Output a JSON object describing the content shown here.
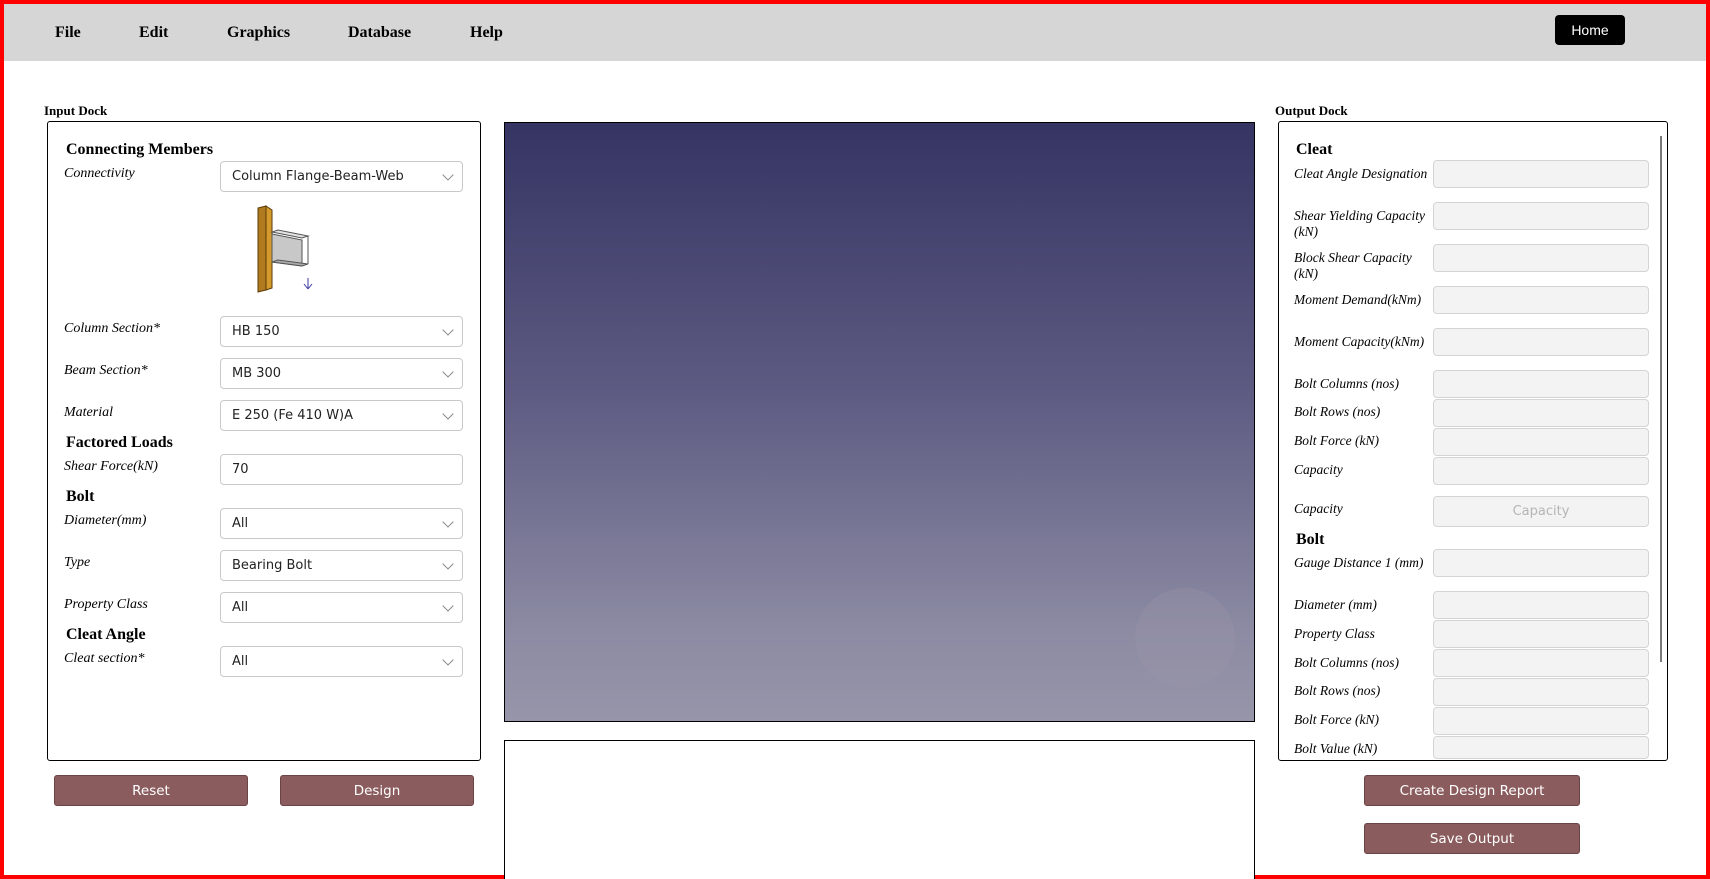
{
  "menubar": {
    "items": [
      "File",
      "Edit",
      "Graphics",
      "Database",
      "Help"
    ],
    "home_label": "Home"
  },
  "input_dock": {
    "title": "Input Dock",
    "sections": {
      "connecting_members": "Connecting Members",
      "factored_loads": "Factored Loads",
      "bolt": "Bolt",
      "cleat_angle": "Cleat Angle"
    },
    "fields": {
      "connectivity": {
        "label": "Connectivity",
        "value": "Column Flange-Beam-Web"
      },
      "column_section": {
        "label": "Column Section*",
        "value": "HB 150"
      },
      "beam_section": {
        "label": "Beam Section*",
        "value": "MB 300"
      },
      "material": {
        "label": "Material",
        "value": "E 250 (Fe 410 W)A"
      },
      "shear_force": {
        "label": "Shear Force(kN)",
        "value": "70"
      },
      "diameter": {
        "label": "Diameter(mm)",
        "value": "All"
      },
      "type": {
        "label": "Type",
        "value": "Bearing Bolt"
      },
      "property_class": {
        "label": "Property Class",
        "value": "All"
      },
      "cleat_section": {
        "label": "Cleat section*",
        "value": "All"
      }
    },
    "buttons": {
      "reset": "Reset",
      "design": "Design"
    }
  },
  "output_dock": {
    "title": "Output Dock",
    "sections": {
      "cleat": "Cleat",
      "bolt": "Bolt"
    },
    "cleat_fields": [
      "Cleat Angle Designation",
      "Shear Yielding Capacity (kN)",
      "Block Shear Capacity (kN)",
      "Moment Demand(kNm)",
      "Moment Capacity(kNm)",
      "Bolt Columns (nos)",
      "Bolt Rows (nos)",
      "Bolt Force (kN)",
      "Capacity",
      "Capacity"
    ],
    "capacity_button_label": "Capacity",
    "bolt_fields": [
      "Gauge Distance 1 (mm)",
      "Diameter (mm)",
      "Property Class",
      "Bolt Columns (nos)",
      "Bolt Rows (nos)",
      "Bolt Force (kN)",
      "Bolt Value (kN)"
    ],
    "buttons": {
      "create_report": "Create Design Report",
      "save_output": "Save Output"
    }
  },
  "colors": {
    "frame": "#ff0000",
    "menubar": "#d5d6d5",
    "button": "#8b5c5e",
    "viewer_top": "#353463",
    "viewer_bottom": "#9695a9"
  }
}
